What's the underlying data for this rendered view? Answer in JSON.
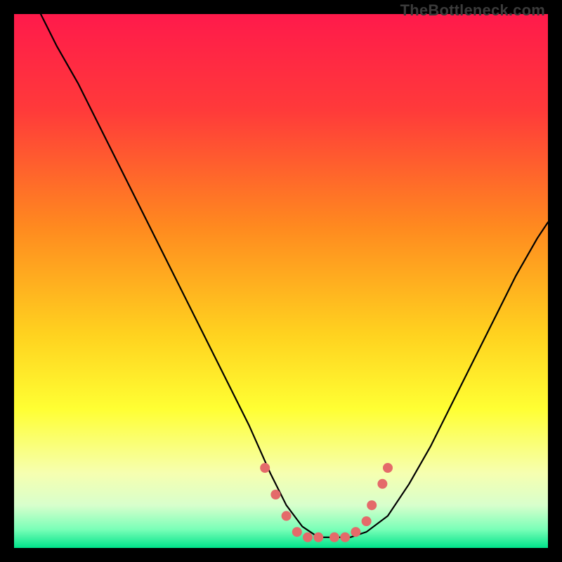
{
  "watermark": "TheBottleneck.com",
  "chart_data": {
    "type": "line",
    "title": "",
    "xlabel": "",
    "ylabel": "",
    "xlim": [
      0,
      100
    ],
    "ylim": [
      0,
      100
    ],
    "gradient_stops": [
      {
        "offset": 0.0,
        "color": "#ff1a4b"
      },
      {
        "offset": 0.18,
        "color": "#ff3a3a"
      },
      {
        "offset": 0.4,
        "color": "#ff8a1f"
      },
      {
        "offset": 0.6,
        "color": "#ffd21f"
      },
      {
        "offset": 0.74,
        "color": "#ffff33"
      },
      {
        "offset": 0.86,
        "color": "#f6ffb0"
      },
      {
        "offset": 0.92,
        "color": "#d8ffcc"
      },
      {
        "offset": 0.965,
        "color": "#7affb8"
      },
      {
        "offset": 1.0,
        "color": "#00e38a"
      }
    ],
    "series": [
      {
        "name": "bottleneck-curve",
        "x": [
          5,
          8,
          12,
          16,
          20,
          25,
          30,
          35,
          40,
          44,
          48,
          51,
          54,
          57,
          60,
          63,
          66,
          70,
          74,
          78,
          82,
          86,
          90,
          94,
          98,
          100
        ],
        "y": [
          100,
          94,
          87,
          79,
          71,
          61,
          51,
          41,
          31,
          23,
          14,
          8,
          4,
          2,
          2,
          2,
          3,
          6,
          12,
          19,
          27,
          35,
          43,
          51,
          58,
          61
        ]
      }
    ],
    "markers": {
      "name": "highlight-points",
      "color": "#e46a6a",
      "radius": 7,
      "points": [
        {
          "x": 47,
          "y": 15
        },
        {
          "x": 49,
          "y": 10
        },
        {
          "x": 51,
          "y": 6
        },
        {
          "x": 53,
          "y": 3
        },
        {
          "x": 55,
          "y": 2
        },
        {
          "x": 57,
          "y": 2
        },
        {
          "x": 60,
          "y": 2
        },
        {
          "x": 62,
          "y": 2
        },
        {
          "x": 64,
          "y": 3
        },
        {
          "x": 66,
          "y": 5
        },
        {
          "x": 67,
          "y": 8
        },
        {
          "x": 69,
          "y": 12
        },
        {
          "x": 70,
          "y": 15
        }
      ]
    }
  }
}
